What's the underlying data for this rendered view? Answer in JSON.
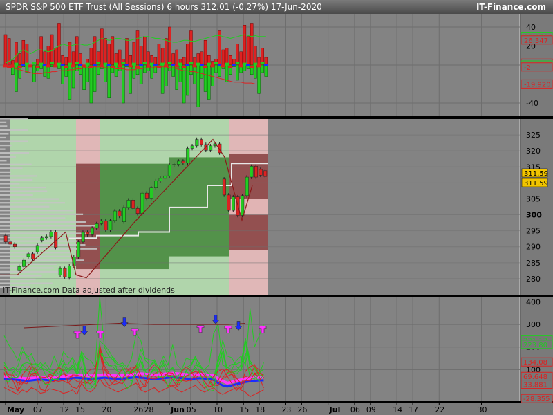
{
  "header": {
    "title": "SPDR S&P 500 ETF Trust (All Sessions)   6 hours   312.01 (-0.27%)   17-Jun-2020",
    "brand": "IT-Finance.com"
  },
  "colors": {
    "up": "#22cc22",
    "down": "#dd2222",
    "price_tag": "#f2c500",
    "panel_bg": "#838383",
    "grid": "#6e6e6e",
    "zone_green_light": "#b2d9ad",
    "zone_green_dark": "#4e8e45",
    "zone_red_light": "#e5b9b9",
    "zone_red_dark": "#8e4a4a",
    "volume_profile": "#c4c4c4",
    "magenta": "#ff33ff",
    "blue": "#1a2aff"
  },
  "chart_data": [
    {
      "panel": "oscillator",
      "type": "bar",
      "yticks": [
        40,
        20,
        0,
        -20,
        -40
      ],
      "value_labels": [
        {
          "text": "30.170",
          "value": 30.17,
          "color": "#22cc22"
        },
        {
          "text": "26.347",
          "value": 26.347,
          "color": "#dd2222"
        },
        {
          "text": "2",
          "value": 2,
          "color": "#dd2222"
        },
        {
          "text": "0",
          "value": 0,
          "color": "#22cc22"
        },
        {
          "text": "-2",
          "value": -2,
          "color": "#dd2222"
        },
        {
          "text": "-19.920",
          "value": -19.92,
          "color": "#dd2222"
        }
      ],
      "ylim": [
        -48,
        48
      ],
      "series": [
        {
          "values": [
            32,
            28,
            5,
            24,
            12,
            26,
            22,
            -20,
            -10,
            6,
            30,
            14,
            20,
            32,
            18,
            44,
            10,
            8,
            24,
            14,
            30,
            12,
            -12,
            6,
            18,
            30,
            14,
            38,
            28,
            22,
            30,
            12,
            16,
            6,
            28,
            10,
            24,
            36,
            20,
            30,
            14,
            10,
            8,
            22,
            18,
            28,
            40,
            12,
            16,
            6,
            8,
            22,
            36,
            8,
            12,
            14,
            26,
            10,
            4,
            6,
            36,
            16,
            18,
            10,
            6,
            22,
            14,
            42,
            30,
            44,
            20,
            8,
            18,
            8
          ]
        },
        {
          "values": [
            6,
            8,
            -10,
            -28,
            -14,
            -2,
            -8,
            4,
            -18,
            -6,
            -4,
            -12,
            -14,
            -2,
            8,
            -4,
            -20,
            -12,
            -36,
            -24,
            -6,
            -10,
            -26,
            -18,
            -40,
            -28,
            -10,
            -4,
            -18,
            -34,
            -8,
            -12,
            -6,
            -40,
            -2,
            -30,
            -14,
            -10,
            -20,
            -8,
            -6,
            -14,
            -8,
            -2,
            -30,
            -22,
            -6,
            -12,
            -26,
            -18,
            -40,
            -32,
            -10,
            -20,
            -44,
            -14,
            -28,
            -36,
            -22,
            -8,
            -12,
            -4,
            -18,
            -10,
            -2,
            -16,
            -8,
            -6,
            -4,
            -10,
            -14,
            -30,
            -8,
            -12
          ]
        },
        {
          "values": [
            -1,
            -2,
            -1,
            1,
            -2,
            0,
            1,
            -1,
            2,
            -2,
            1,
            0,
            -1,
            2,
            -1,
            1,
            0,
            -2,
            1,
            -1,
            2,
            0,
            -1,
            1,
            -2,
            0,
            2,
            -1,
            1,
            0,
            -2,
            1,
            -1,
            2,
            0,
            -1,
            1,
            -2,
            0,
            2,
            -1,
            1,
            0,
            -2,
            1,
            -1,
            2,
            0,
            -1,
            1,
            -2,
            0,
            2,
            -1,
            1,
            0,
            -2,
            1,
            -1,
            2,
            0,
            -1,
            1,
            -2,
            0,
            2,
            -1,
            1,
            0,
            -2,
            1,
            -1,
            2,
            0
          ]
        },
        {
          "values": [
            2,
            4,
            6,
            10,
            14,
            16,
            14,
            12,
            14,
            16,
            16,
            15,
            14,
            15,
            18,
            20,
            22,
            21,
            20,
            21,
            22,
            22,
            21,
            21,
            22,
            24,
            26,
            28,
            27,
            26,
            27,
            28,
            28,
            27,
            26,
            26,
            27,
            28,
            29,
            30,
            30,
            29,
            28,
            28,
            27,
            26,
            25,
            24,
            24,
            25,
            26,
            26,
            25,
            25,
            26,
            27,
            28,
            29,
            30,
            31,
            31,
            30,
            29,
            28,
            29,
            30,
            31,
            32,
            31,
            30,
            31,
            30,
            30,
            30
          ]
        },
        {
          "values": [
            -1,
            -2,
            -3,
            -4,
            -5,
            -6,
            -7,
            -8,
            -9,
            -9,
            -9,
            -8,
            -8,
            -7,
            -7,
            -6,
            -6,
            -6,
            -5,
            -5,
            -4,
            -4,
            -3,
            -3,
            -2,
            -2,
            -2,
            -2,
            -3,
            -3,
            -3,
            -4,
            -4,
            -4,
            -5,
            -5,
            -5,
            -4,
            -4,
            -3,
            -3,
            -3,
            -2,
            -2,
            -2,
            -2,
            -3,
            -3,
            -4,
            -5,
            -6,
            -6,
            -7,
            -7,
            -8,
            -9,
            -10,
            -11,
            -12,
            -13,
            -14,
            -15,
            -16,
            -17,
            -18,
            -18,
            -18,
            -19,
            -19,
            -19,
            -20,
            -20,
            -20,
            -20
          ]
        }
      ]
    },
    {
      "panel": "price",
      "type": "candlestick",
      "ylim": [
        275,
        330
      ],
      "yticks": [
        325,
        320,
        315,
        310,
        305,
        300,
        295,
        290,
        285,
        280
      ],
      "price_tags": [
        311.59,
        311.59
      ],
      "watermark": "IT-Finance.com  Data adjusted after dividends",
      "series": [
        {
          "values": [
            293.5,
            291.5,
            290.8,
            282.5,
            283.8,
            286.9,
            287.8,
            288.4,
            292.0,
            292.8,
            293.2,
            294.6,
            281.2,
            283.2,
            280.3,
            284.0,
            286.8,
            291.5,
            294.5,
            293.8,
            295.8,
            297.2,
            298.0,
            295.2,
            298.2,
            301.2,
            297.8,
            302.3,
            304.6,
            302.0,
            300.4,
            306.8,
            305.2,
            308.4,
            310.6,
            311.4,
            312.2,
            315.6,
            315.8,
            316.8,
            316.2,
            320.8,
            321.6,
            323.6,
            322.0,
            320.2,
            321.6,
            322.2,
            311.2,
            306.2,
            301.4,
            305.6,
            299.8,
            306.0,
            311.8,
            315.2,
            314.2,
            313.8
          ]
        },
        {
          "values": [
            291.5,
            290.8,
            290.0,
            283.8,
            285.8,
            287.8,
            286.2,
            290.4,
            292.8,
            293.2,
            294.6,
            289.8,
            283.2,
            280.6,
            284.0,
            286.8,
            291.5,
            294.5,
            293.8,
            295.8,
            297.2,
            298.0,
            295.2,
            298.2,
            301.2,
            299.6,
            302.3,
            304.6,
            302.0,
            300.4,
            306.8,
            305.2,
            308.4,
            310.6,
            311.4,
            312.2,
            315.6,
            315.8,
            316.8,
            316.2,
            320.8,
            321.6,
            323.6,
            322.0,
            320.2,
            321.6,
            322.2,
            319.4,
            306.2,
            301.4,
            305.6,
            299.8,
            306.0,
            311.8,
            315.2,
            311.8,
            312.4,
            312.0
          ]
        }
      ]
    },
    {
      "panel": "breadth",
      "type": "line",
      "ylim": [
        -40,
        420
      ],
      "yticks": [
        400,
        300,
        200,
        100
      ],
      "value_labels": [
        {
          "text": "231.13",
          "value": 231.13,
          "color": "#22cc22"
        },
        {
          "text": "223.80",
          "value": 212,
          "color": "#22cc22"
        },
        {
          "text": "134.08",
          "value": 134.08,
          "color": "#dd2222"
        },
        {
          "text": "69.648",
          "value": 69.648,
          "color": "#dd2222"
        },
        {
          "text": "33.881",
          "value": 35,
          "color": "#dd2222"
        },
        {
          "text": "-28.355",
          "value": -28.355,
          "color": "#dd2222"
        }
      ],
      "series": [
        {
          "values": [
            250,
            210,
            180,
            140,
            200,
            150,
            170,
            120,
            110,
            130,
            100,
            160,
            110,
            140,
            100,
            120,
            90,
            180,
            150,
            140,
            110,
            420,
            200,
            160,
            140,
            120,
            130,
            110,
            150,
            260,
            230,
            140,
            120,
            130,
            110,
            160,
            120,
            210,
            120,
            100,
            110,
            120,
            160,
            110,
            100,
            120,
            260,
            300,
            120,
            110,
            100,
            140,
            160,
            120,
            370,
            200,
            250,
            300
          ]
        },
        {
          "values": [
            120,
            100,
            110,
            90,
            120,
            100,
            80,
            90,
            110,
            100,
            90,
            100,
            80,
            120,
            90,
            110,
            80,
            160,
            80,
            70,
            60,
            200,
            150,
            120,
            110,
            90,
            100,
            80,
            90,
            120,
            160,
            90,
            80,
            100,
            70,
            120,
            90,
            110,
            80,
            70,
            90,
            80,
            110,
            90,
            80,
            70,
            60,
            150,
            200,
            100,
            90,
            80,
            100,
            220,
            130,
            110,
            90,
            100
          ]
        },
        {
          "values": [
            80,
            60,
            70,
            40,
            60,
            50,
            80,
            70,
            50,
            60,
            80,
            70,
            60,
            50,
            40,
            60,
            70,
            80,
            60,
            50,
            60,
            180,
            100,
            80,
            70,
            60,
            50,
            60,
            80,
            100,
            70,
            60,
            80,
            70,
            60,
            50,
            70,
            80,
            60,
            70,
            60,
            50,
            60,
            80,
            70,
            60,
            50,
            40,
            60,
            70,
            80,
            60,
            50,
            70,
            60,
            80,
            70,
            60
          ]
        },
        {
          "values": [
            20,
            10,
            0,
            -10,
            10,
            0,
            20,
            10,
            -5,
            0,
            15,
            10,
            5,
            -5,
            0,
            10,
            -10,
            40,
            10,
            0,
            20,
            60,
            30,
            20,
            10,
            0,
            10,
            20,
            30,
            40,
            10,
            0,
            10,
            20,
            0,
            10,
            20,
            30,
            10,
            0,
            10,
            20,
            30,
            10,
            0,
            10,
            20,
            0,
            -10,
            0,
            10,
            20,
            10,
            0,
            -20,
            -10,
            0,
            10
          ]
        },
        {
          "values": [
            70,
            68,
            66,
            64,
            62,
            60,
            62,
            64,
            66,
            65,
            64,
            66,
            68,
            70,
            72,
            74,
            76,
            76,
            74,
            72,
            74,
            76,
            78,
            76,
            74,
            72,
            74,
            76,
            78,
            80,
            82,
            80,
            78,
            76,
            78,
            80,
            82,
            84,
            82,
            80,
            78,
            76,
            78,
            80,
            78,
            76,
            74,
            60,
            50,
            40,
            45,
            50,
            55,
            60,
            62,
            64,
            66,
            66
          ]
        },
        {
          "values": [
            60,
            58,
            56,
            54,
            52,
            50,
            52,
            54,
            56,
            54,
            52,
            54,
            56,
            58,
            60,
            62,
            64,
            62,
            60,
            58,
            60,
            62,
            64,
            62,
            60,
            58,
            60,
            62,
            64,
            66,
            64,
            62,
            60,
            58,
            60,
            62,
            64,
            66,
            64,
            62,
            60,
            58,
            60,
            62,
            60,
            58,
            56,
            40,
            30,
            25,
            30,
            35,
            40,
            45,
            48,
            50,
            52,
            52
          ]
        }
      ]
    }
  ],
  "x_axis": {
    "ticks": [
      "May",
      "07",
      "12",
      "15",
      "20",
      "26",
      "28",
      "Jun",
      "05",
      "10",
      "15",
      "18",
      "23",
      "26",
      "Jul",
      "06",
      "09",
      "14",
      "17",
      "22",
      "30"
    ],
    "month_ticks": [
      "May",
      "Jun",
      "Jul"
    ]
  }
}
